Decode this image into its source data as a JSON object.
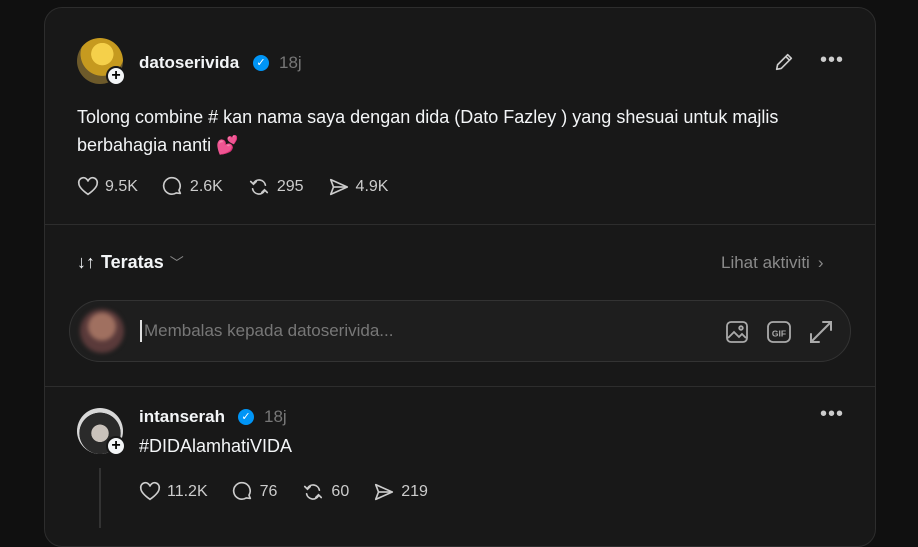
{
  "post": {
    "username": "datoserivida",
    "time": "18j",
    "text": "Tolong combine # kan nama saya dengan dida (Dato Fazley ) yang shesuai untuk majlis berbahagia nanti 💕",
    "likes": "9.5K",
    "comments": "2.6K",
    "reposts": "295",
    "shares": "4.9K"
  },
  "sort": {
    "label": "Teratas"
  },
  "activity_link": "Lihat aktiviti",
  "reply_box": {
    "placeholder": "Membalas kepada datoserivida..."
  },
  "reply": {
    "username": "intanserah",
    "time": "18j",
    "text": "#DIDAlamhatiVIDA",
    "likes": "11.2K",
    "comments": "76",
    "reposts": "60",
    "shares": "219"
  },
  "colors": {
    "verified": "#0095f6",
    "background": "#101010",
    "card": "#181818"
  }
}
